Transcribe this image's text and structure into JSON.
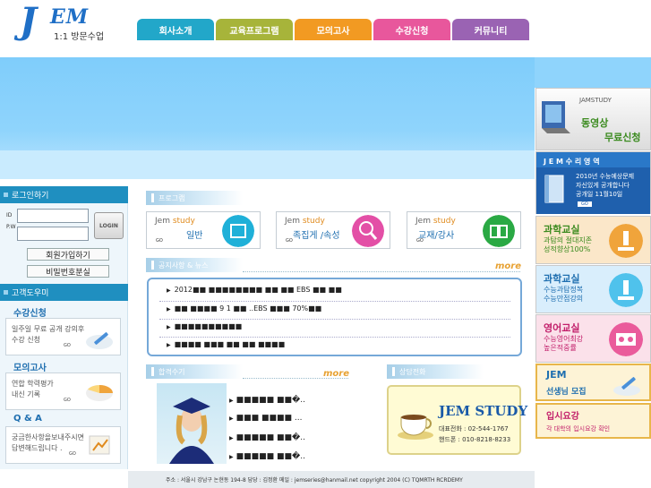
{
  "brand": {
    "logo_j": "J",
    "logo_em": "EM",
    "tagline": "1:1 방문수업"
  },
  "nav": [
    {
      "label": "회사소개",
      "color": "#22a7c9"
    },
    {
      "label": "교육프로그램",
      "color": "#a7b43a"
    },
    {
      "label": "모의고사",
      "color": "#f29a22"
    },
    {
      "label": "수강신청",
      "color": "#e8579c"
    },
    {
      "label": "커뮤니티",
      "color": "#9a63b3"
    }
  ],
  "login": {
    "title": "로그인하기",
    "id_label": "ID",
    "pw_label": "P.W",
    "button": "LOGIN",
    "join": "회원가입하기",
    "find_pw": "비밀번호분실"
  },
  "help": {
    "title": "고객도우미",
    "sections": [
      {
        "title": "수강신청",
        "text1": "일주일 무료 공개 강의후",
        "text2": "수강 신청",
        "go": "GO"
      },
      {
        "title": "모의고사",
        "text1": "연합 학력평가",
        "text2": "내신 기록",
        "go": "GO"
      },
      {
        "title": "Q & A",
        "text1": "궁금한사항을보내주시면",
        "text2": "답변해드립니다 .",
        "go": "GO"
      }
    ]
  },
  "program": {
    "title": "프로그램",
    "items": [
      {
        "jem": "Jem",
        "study": "study",
        "name": "일반",
        "go": "GO"
      },
      {
        "jem": "Jem",
        "study": "study",
        "name": "족집게 /속성",
        "go": "GO"
      },
      {
        "jem": "Jem",
        "study": "study",
        "name": "교재/강사",
        "go": "GO"
      }
    ]
  },
  "notice": {
    "title": "공지사항 & 뉴스",
    "more": "more",
    "rows": [
      "2012■■ ■■■■■■■■ ■■ ■■ EBS ■■ ■■",
      "■■ ■■■■ 9 1 ■■ ..EBS ■■■ 70%■■",
      "■■■■■■■■■■",
      "■■■■ ■■■ ■■ ■■ ■■■■"
    ]
  },
  "success": {
    "title": "합격수기",
    "more": "more",
    "rows": [
      "■■■■■ ■■�..",
      "■■■ ■■■■ ...",
      "■■■■■ ■■�..",
      "■■■■■ ■■�.."
    ]
  },
  "contact": {
    "title": "상담전화",
    "brand": "JEM STUDY",
    "phone": "대표전화 : 02-544-1767",
    "mobile": "핸드폰 : 010-8218-8233"
  },
  "right": {
    "video": {
      "label": "JAMSTUDY",
      "t1": "동영상",
      "t2": "무료신청"
    },
    "math": {
      "title": "J E M 수 리 영 역",
      "l1": "2010년 수능예상문제",
      "l2": "자신있게 공개합니다",
      "l3": "공개일 11월10일",
      "go": "GO"
    },
    "boxes": [
      {
        "t1": "과학교실",
        "l1": "과탐의 절대지존",
        "l2": "성적향상100%",
        "bg": "#fbe7c9",
        "c1": "#3a8a1e",
        "c2": "#3a8a1e",
        "icon": "#f0a43b"
      },
      {
        "t1": "과학교실",
        "l1": "수능과탐정복",
        "l2": "수능만점강의",
        "bg": "#d9eefc",
        "c1": "#1f6fb0",
        "c2": "#1f6fb0",
        "icon": "#4fc2ec"
      },
      {
        "t1": "영어교실",
        "l1": "수능영어최강",
        "l2": "높은적중률",
        "bg": "#fbe1ea",
        "c1": "#c21e6a",
        "c2": "#c21e6a",
        "icon": "#ea5b9b"
      }
    ],
    "teacher": {
      "t1": "JEM",
      "t2": "선생님 모집"
    },
    "admission": {
      "t1": "입시요강",
      "t2": "각 대학의 입시요강 확인"
    }
  },
  "footer": {
    "text": "주소 : 서울시 강남구 논현동 194-8    담당 : 김정환    메일 : jemseries@hanmail.net    copyright 2004 (C) TQMRTH RCRDEMY"
  }
}
